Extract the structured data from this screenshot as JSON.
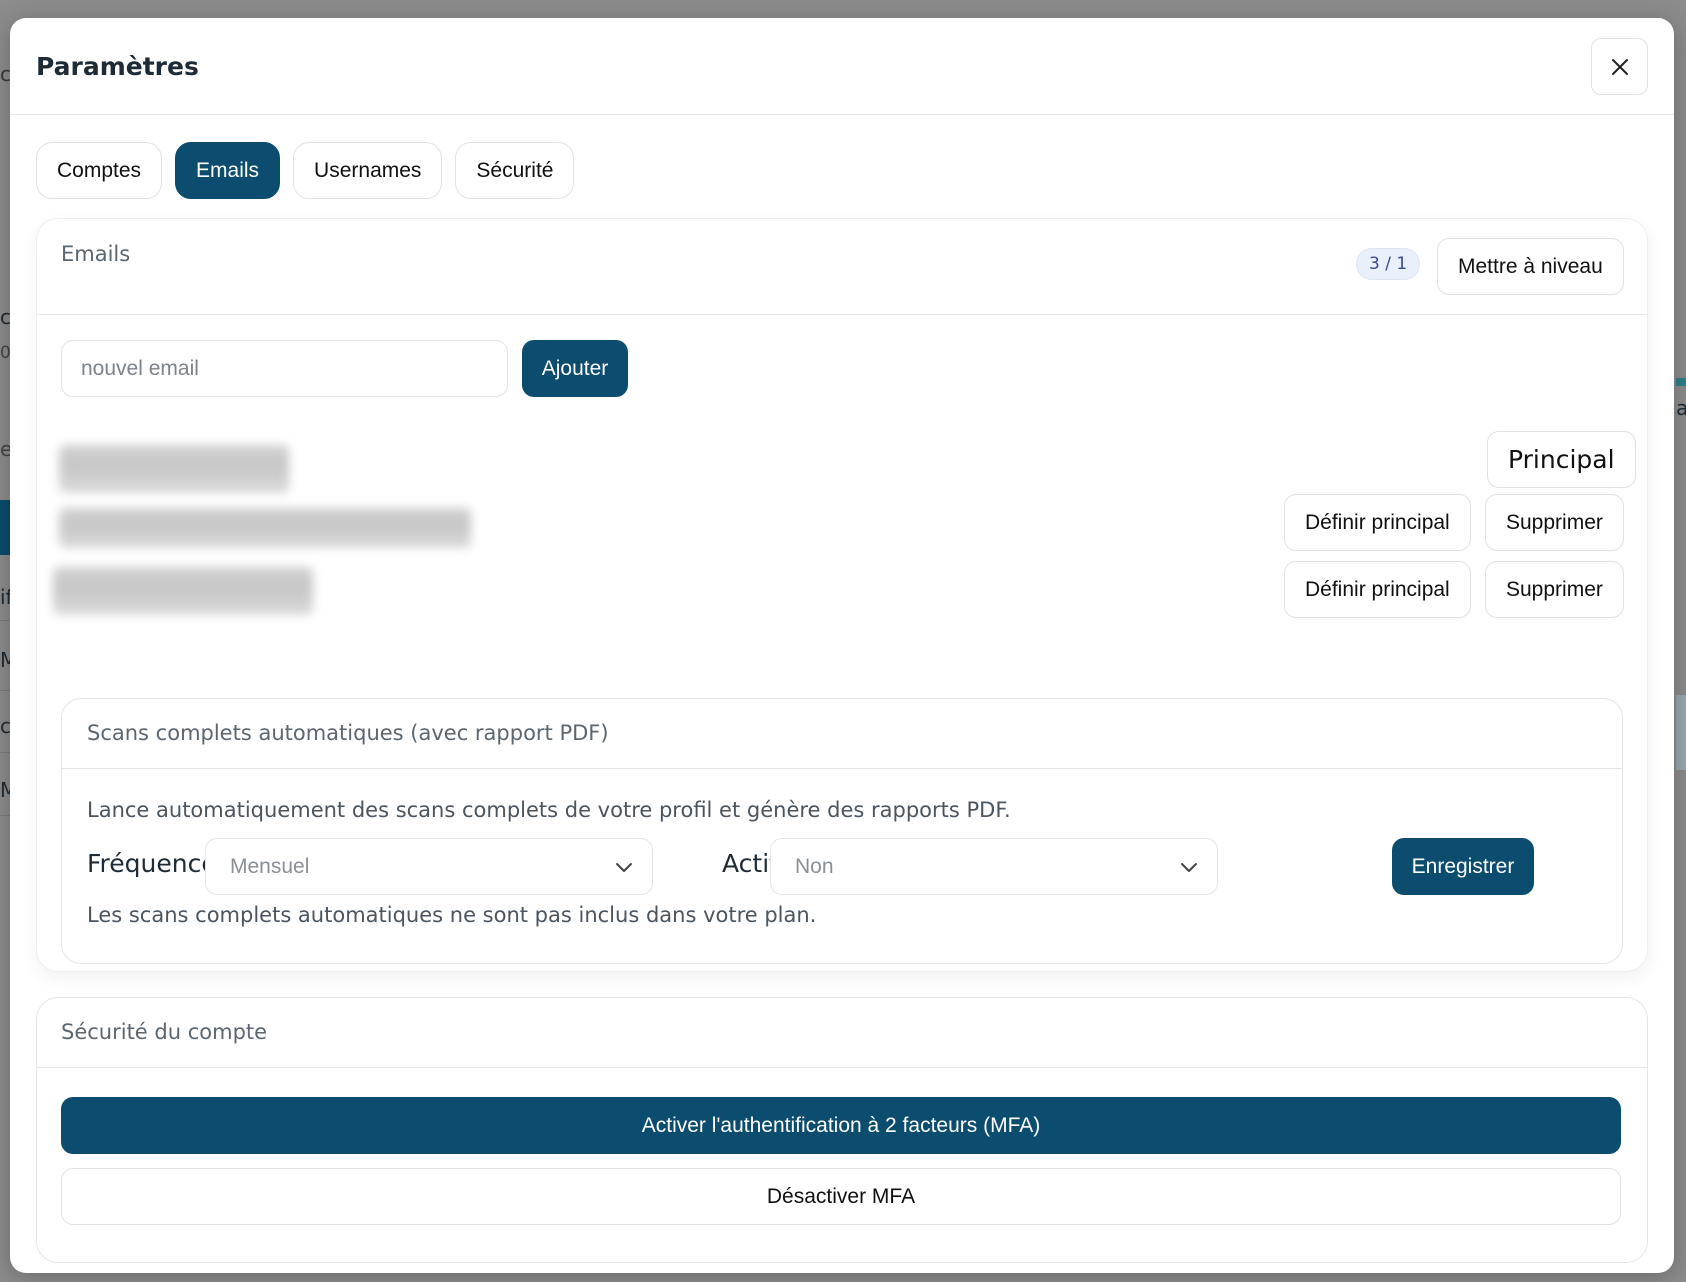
{
  "modal": {
    "title": "Paramètres",
    "close_label": "×"
  },
  "tabs": [
    {
      "label": "Comptes",
      "active": false
    },
    {
      "label": "Emails",
      "active": true
    },
    {
      "label": "Usernames",
      "active": false
    },
    {
      "label": "Sécurité",
      "active": false
    }
  ],
  "emails_card": {
    "title": "Emails",
    "usage_badge": "3 / 1",
    "upgrade_label": "Mettre à niveau",
    "new_email_placeholder": "nouvel email",
    "new_email_value": "",
    "add_label": "Ajouter",
    "rows": [
      {
        "primary_label": "Principal"
      },
      {
        "set_primary_label": "Définir principal",
        "delete_label": "Supprimer"
      },
      {
        "set_primary_label": "Définir principal",
        "delete_label": "Supprimer"
      }
    ]
  },
  "auto_scans": {
    "title": "Scans complets automatiques (avec rapport PDF)",
    "description": "Lance automatiquement des scans complets de votre profil et génère des rapports PDF.",
    "frequency_label": "Fréquence",
    "frequency_value": "Mensuel",
    "active_label": "Actif",
    "active_value": "Non",
    "save_label": "Enregistrer",
    "note": "Les scans complets automatiques ne sont pas inclus dans votre plan."
  },
  "account_security": {
    "title": "Sécurité du compte",
    "enable_mfa_label": "Activer l'authentification à 2 facteurs (MFA)",
    "disable_mfa_label": "Désactiver MFA"
  },
  "background": {
    "fragments": [
      "c",
      "cy",
      "0",
      "e",
      "if",
      "Mi",
      "ca",
      "Mi",
      "al"
    ]
  },
  "colors": {
    "accent": "#0b4c6f",
    "overlay": "#8c8c8c",
    "badge_bg": "#e9effb"
  }
}
